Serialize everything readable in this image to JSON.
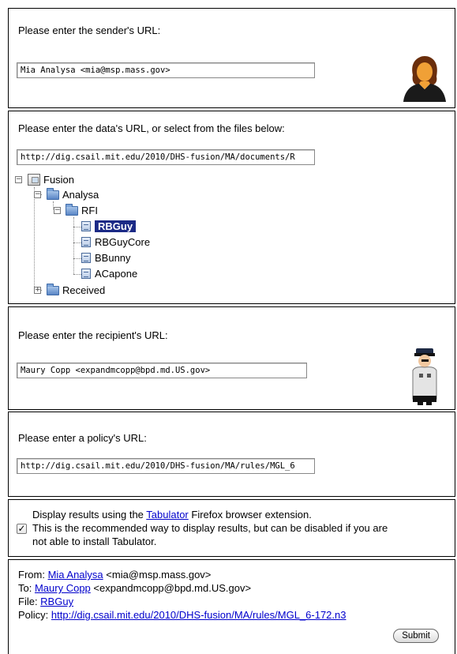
{
  "sender": {
    "label": "Please enter the sender's URL:",
    "value": "Mia Analysa <mia@msp.mass.gov>"
  },
  "data_file": {
    "label": "Please enter the data's URL, or select from the files below:",
    "value": "http://dig.csail.mit.edu/2010/DHS-fusion/MA/documents/R",
    "tree": {
      "root": "Fusion",
      "analysa": "Analysa",
      "rfi": "RFI",
      "files": [
        "RBGuy",
        "RBGuyCore",
        "BBunny",
        "ACapone"
      ],
      "received": "Received"
    }
  },
  "recipient": {
    "label": "Please enter the recipient's URL:",
    "value": "Maury Copp <expandmcopp@bpd.md.US.gov>"
  },
  "policy": {
    "label": "Please enter a policy's URL:",
    "value": "http://dig.csail.mit.edu/2010/DHS-fusion/MA/rules/MGL_6"
  },
  "tabulator": {
    "text_before": "Display results using the ",
    "link": "Tabulator",
    "text_after": " Firefox browser extension.",
    "line2": "This is the recommended way to display results, but can be disabled if you are",
    "line3": "not able to install Tabulator.",
    "checked": true
  },
  "summary": {
    "from_label": "From: ",
    "from_name": "Mia Analysa",
    "from_email": " <mia@msp.mass.gov>",
    "to_label": "To: ",
    "to_name": "Maury Copp",
    "to_email": " <expandmcopp@bpd.md.US.gov>",
    "file_label": "File: ",
    "file_name": "RBGuy",
    "policy_label": "Policy: ",
    "policy_url": "http://dig.csail.mit.edu/2010/DHS-fusion/MA/rules/MGL_6-172.n3",
    "submit": "Submit"
  }
}
